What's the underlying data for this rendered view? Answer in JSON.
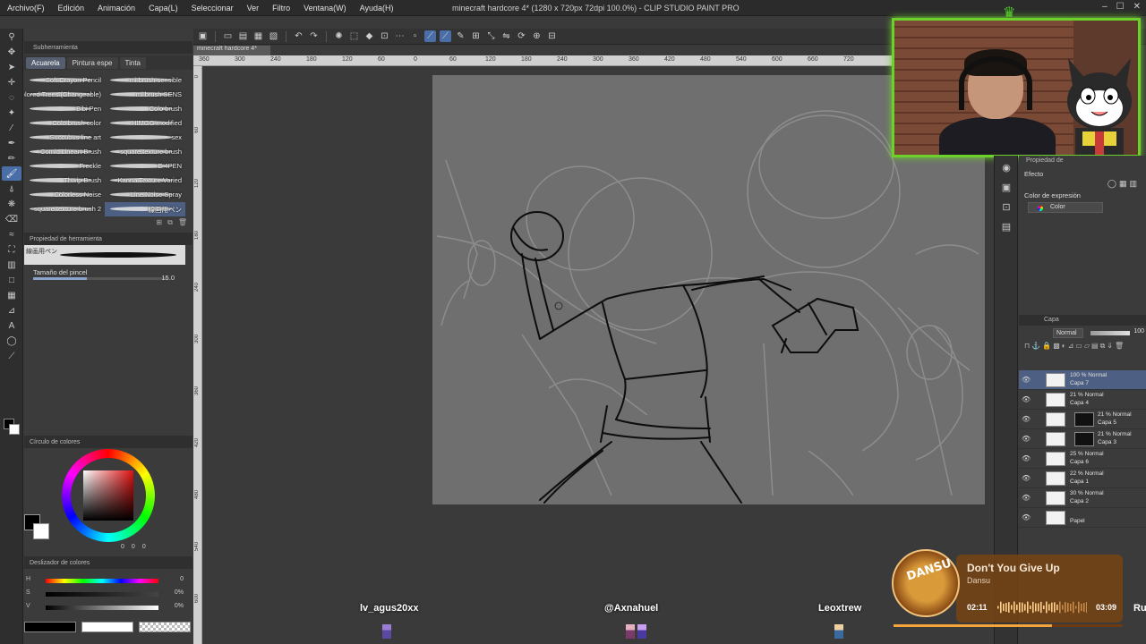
{
  "menubar": {
    "items": [
      "Archivo(F)",
      "Edición",
      "Animación",
      "Capa(L)",
      "Seleccionar",
      "Ver",
      "Filtro",
      "Ventana(W)",
      "Ayuda(H)"
    ],
    "title": "minecraft hardcore 4* (1280 x 720px 72dpi 100.0%) - CLIP STUDIO PAINT PRO"
  },
  "document_tab": "minecraft hardcore 4*",
  "ruler": {
    "ticks": [
      "360",
      "300",
      "240",
      "180",
      "120",
      "60",
      "0",
      "60",
      "120",
      "180",
      "240",
      "300",
      "360",
      "420",
      "480",
      "540",
      "600",
      "660",
      "720"
    ],
    "vticks": [
      "0",
      "60",
      "120",
      "180",
      "240",
      "300",
      "360",
      "420",
      "480",
      "540",
      "600"
    ]
  },
  "subtool_panel": {
    "header": "Subherramienta",
    "tabs": [
      "Acuarela",
      "Pintura espe",
      "Tinta"
    ],
    "active_tab": "Acuarela",
    "brushes": [
      {
        "name": "Soft Crayon Pencil"
      },
      {
        "name": "mi brush sensible"
      },
      {
        "name": "Colored Trees (Changeable)"
      },
      {
        "name": "mi brush SENS"
      },
      {
        "name": "Bibi Pen"
      },
      {
        "name": "Colo brush"
      },
      {
        "name": "Colo brush color"
      },
      {
        "name": "HIMGG modified"
      },
      {
        "name": "Succubus line art"
      },
      {
        "name": "sex"
      },
      {
        "name": "Comic Lineart Brush"
      },
      {
        "name": "square texture brush"
      },
      {
        "name": "Freckle"
      },
      {
        "name": "E 4PEN"
      },
      {
        "name": "Thwip Brush"
      },
      {
        "name": "Kanna Texture Varied"
      },
      {
        "name": "Colorless Noise"
      },
      {
        "name": "Line Noise Spray"
      },
      {
        "name": "square texture brush 2"
      },
      {
        "name": "線画用ペン"
      }
    ],
    "selected_brush": "線画用ペン"
  },
  "tool_property": {
    "header": "Propiedad de herramienta",
    "preview_label": "線画用ペン",
    "size_label": "Tamaño del pincel",
    "size_value": "15.0",
    "size_fraction": 0.4
  },
  "color_wheel": {
    "header": "Círculo de colores",
    "values": [
      "0",
      "0",
      "0"
    ],
    "main_color": "#000000",
    "sub_color": "#ffffff"
  },
  "color_slider": {
    "header": "Deslizador de colores",
    "rows": [
      {
        "label": "H",
        "value": "0"
      },
      {
        "label": "S",
        "value": "0%"
      },
      {
        "label": "V",
        "value": "0%"
      }
    ]
  },
  "layer_property": {
    "tab": "Propiedad de",
    "effect_label": "Efecto",
    "expression_label": "Color de expresión",
    "expression_value": "Color"
  },
  "layers_panel": {
    "header": "Capa",
    "blend_mode": "Normal",
    "opacity": "100",
    "layers": [
      {
        "mode": "100 % Normal",
        "name": "Capa 7",
        "selected": true,
        "mask": false
      },
      {
        "mode": "21 % Normal",
        "name": "Capa 4",
        "selected": false,
        "mask": false
      },
      {
        "mode": "21 % Normal",
        "name": "Capa 5",
        "selected": false,
        "mask": true
      },
      {
        "mode": "21 % Normal",
        "name": "Capa 3",
        "selected": false,
        "mask": true
      },
      {
        "mode": "25 % Normal",
        "name": "Capa 6",
        "selected": false,
        "mask": false
      },
      {
        "mode": "22 % Normal",
        "name": "Capa 1",
        "selected": false,
        "mask": false
      },
      {
        "mode": "30 % Normal",
        "name": "Capa 2",
        "selected": false,
        "mask": false
      },
      {
        "mode": "",
        "name": "Papel",
        "selected": false,
        "mask": false
      }
    ]
  },
  "music": {
    "title": "Don't You Give Up",
    "artist": "Dansu",
    "art_text": "DANSU",
    "current": "02:11",
    "total": "03:09",
    "progress": 0.69
  },
  "chat": {
    "names": [
      "lv_agus20xx",
      "@Axnahuel",
      "Leoxtrew"
    ],
    "partial": "Ru"
  },
  "colors": {
    "accent": "#4a6fa8",
    "webcam_border": "#6cd12b",
    "canvas_bg": "#6f6f6f"
  }
}
